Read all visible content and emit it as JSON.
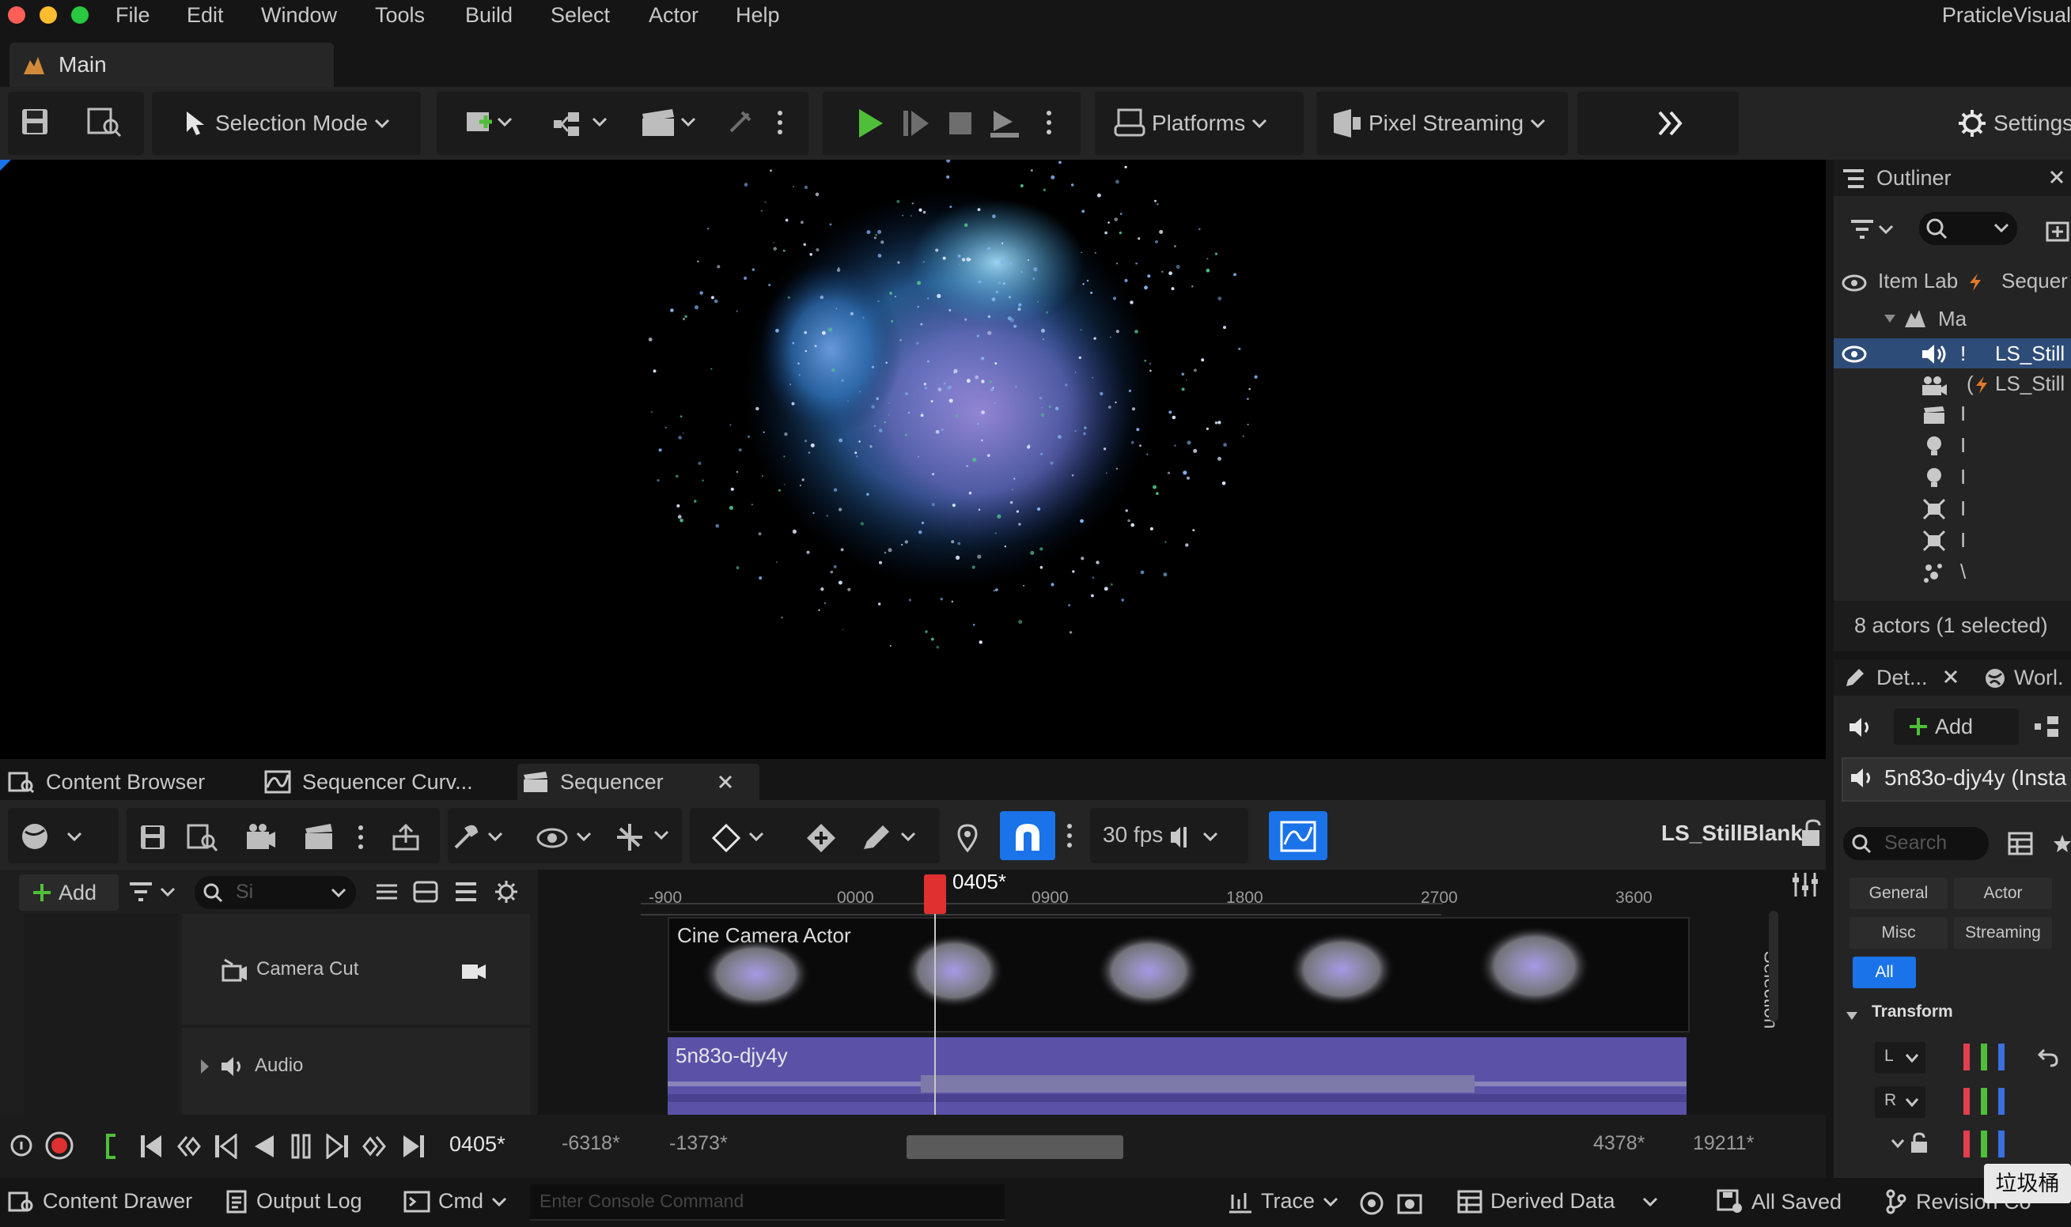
{
  "menubar": {
    "items": [
      "File",
      "Edit",
      "Window",
      "Tools",
      "Build",
      "Select",
      "Actor",
      "Help"
    ],
    "app_name": "PraticleVisual"
  },
  "tabs": {
    "main": "Main"
  },
  "toolbar": {
    "selection_mode": "Selection Mode",
    "platforms": "Platforms",
    "pixel_streaming": "Pixel Streaming",
    "settings": "Settings"
  },
  "outliner": {
    "title": "Outliner",
    "col_label": "Item Lab",
    "col_type": "Sequer",
    "root": "Ma",
    "rows": [
      "LS_Still",
      "LS_Still"
    ],
    "footer": "8 actors (1 selected)"
  },
  "details": {
    "tab_details": "Det...",
    "tab_world": "Worl.",
    "add": "Add",
    "object_name": "5n83o-djy4y (Insta",
    "search_placeholder": "Search",
    "filters": [
      "General",
      "Actor",
      "Misc",
      "Streaming",
      "All"
    ],
    "section_transform": "Transform",
    "transform_rows": [
      "L",
      "R"
    ]
  },
  "bottom_tabs": {
    "content_browser": "Content Browser",
    "sequencer_curves": "Sequencer Curv...",
    "sequencer": "Sequencer"
  },
  "sequencer": {
    "fps": "30 fps",
    "sequence_name": "LS_StillBlank",
    "add": "Add",
    "search_value": "Si",
    "playhead": "0405*",
    "ruler_ticks": [
      "-900",
      "0000",
      "0900",
      "1800",
      "2700",
      "3600"
    ],
    "tracks": [
      {
        "label": "Camera Cut",
        "clip": "Cine Camera Actor"
      },
      {
        "label": "Audio",
        "clip": "5n83o-djy4y"
      }
    ],
    "side_label": "Selection",
    "current_frame": "0405*",
    "range_start": "-6318*",
    "view_start": "-1373*",
    "view_end": "4378*",
    "range_end": "19211*"
  },
  "statusbar": {
    "content_drawer": "Content Drawer",
    "output_log": "Output Log",
    "cmd": "Cmd",
    "console_placeholder": "Enter Console Command",
    "trace": "Trace",
    "derived_data": "Derived Data",
    "all_saved": "All Saved",
    "revision": "Revision Co",
    "tooltip": "垃圾桶"
  },
  "colors": {
    "accent_blue": "#1a73e8",
    "play_green": "#4fbf3a",
    "playhead_red": "#e03030",
    "clip_purple": "#6a5fb5"
  }
}
